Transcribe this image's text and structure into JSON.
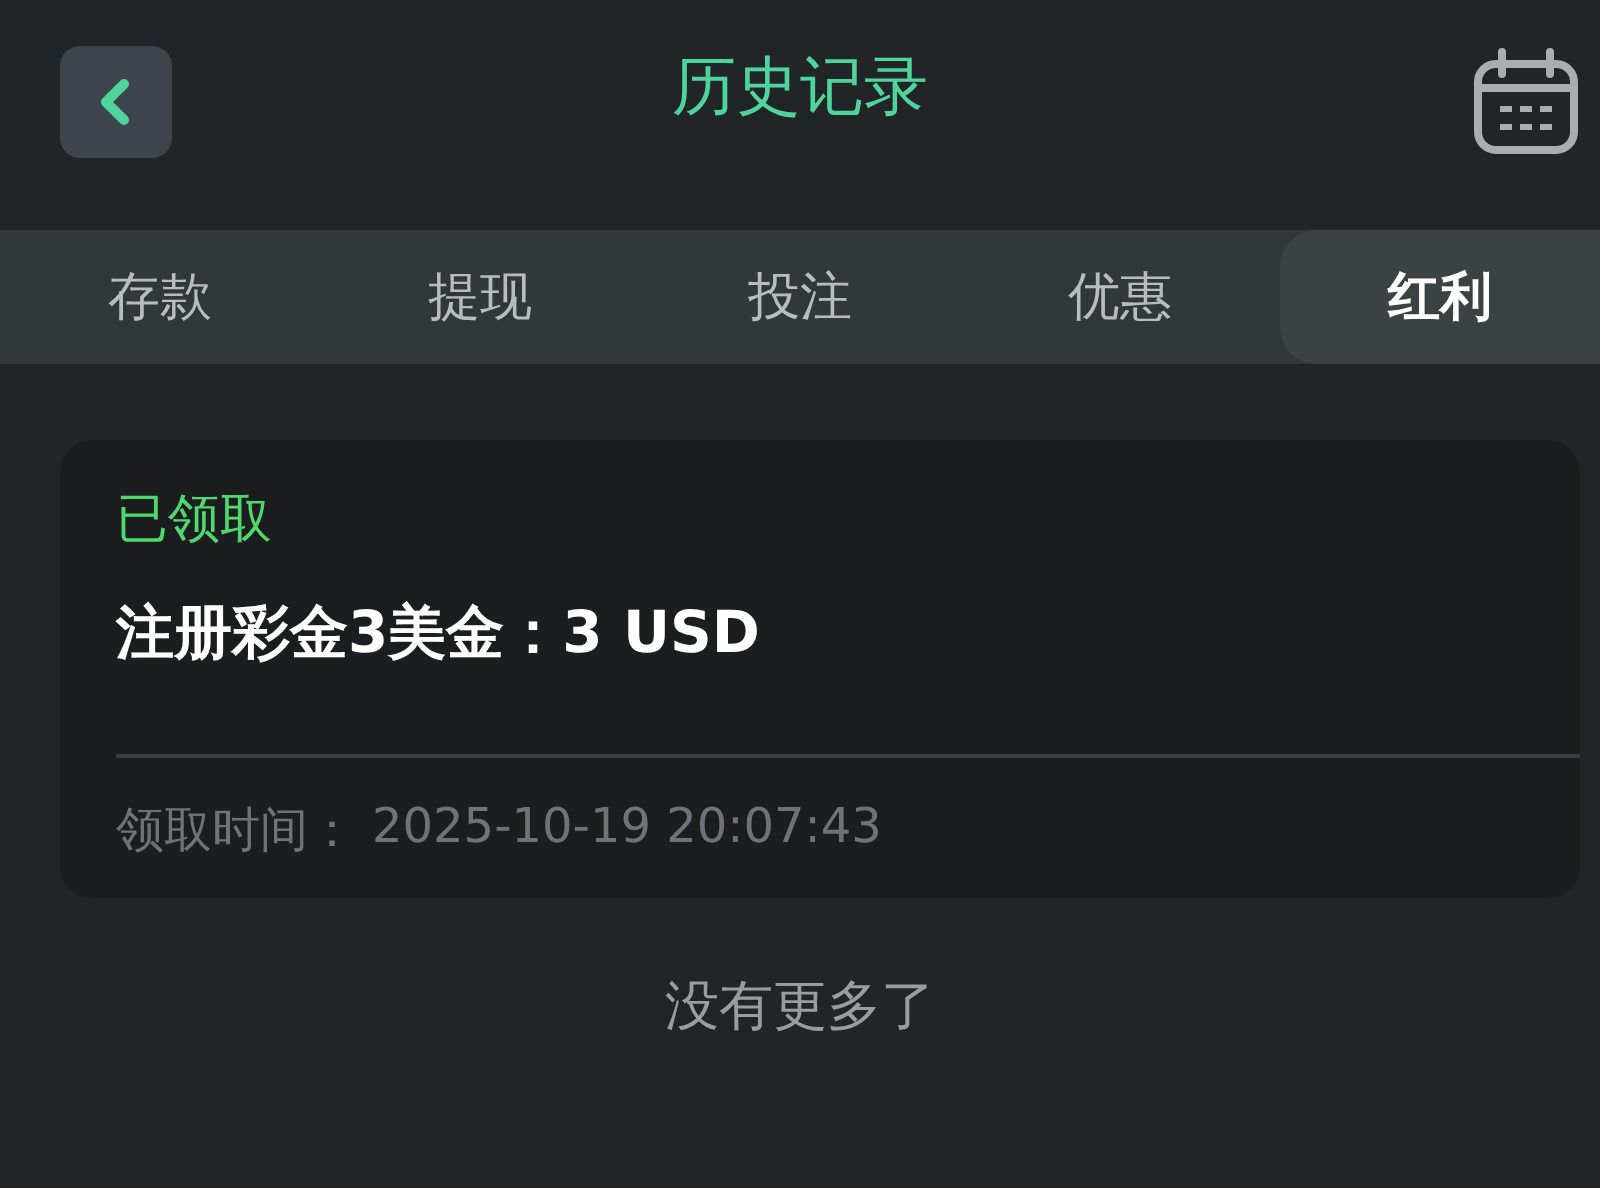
{
  "header": {
    "title": "历史记录"
  },
  "tabs": [
    {
      "label": "存款",
      "selected": false
    },
    {
      "label": "提现",
      "selected": false
    },
    {
      "label": "投注",
      "selected": false
    },
    {
      "label": "优惠",
      "selected": false
    },
    {
      "label": "红利",
      "selected": true
    }
  ],
  "records": [
    {
      "status": "已领取",
      "title": "注册彩金3美金：3 USD",
      "time_label": "领取时间：",
      "time": "2025-10-19 20:07:43"
    }
  ],
  "footer": "没有更多了"
}
